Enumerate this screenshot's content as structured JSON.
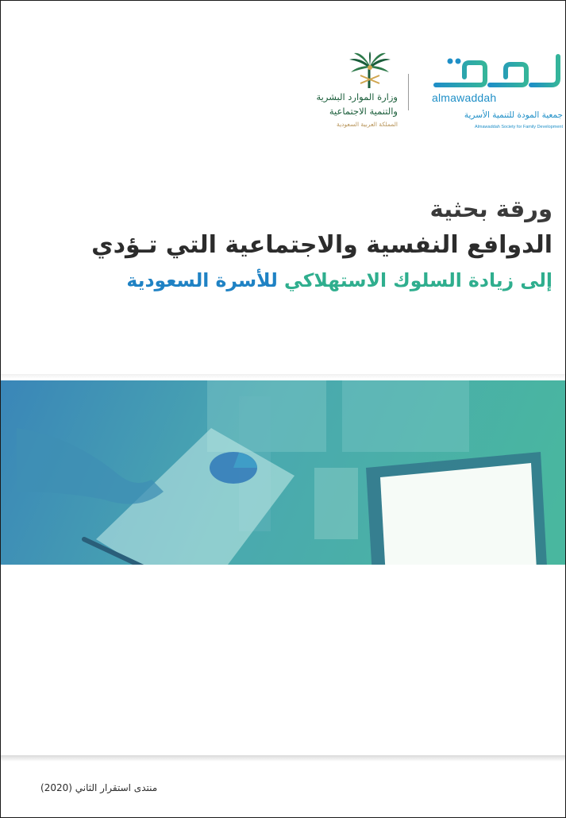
{
  "logos": {
    "mawaddah": {
      "mark_text": "المودة",
      "latin": "almawaddah",
      "arabic_name": "جمعية المودة للتنمية الأسرية",
      "english_name": "Almawaddah Society for Family Development"
    },
    "ministry": {
      "line1": "وزارة الموارد البشرية",
      "line2": "والتنمية الاجتماعية",
      "line3": "المملكة العربية السعودية"
    }
  },
  "title": {
    "line1": "ورقة بحثية",
    "line2": "الدوافع النفسية والاجتماعية التي تـؤدي",
    "line3_part1": "إلى زيادة السلوك الاستهلاكي",
    "line3_part2": " للأسرة السعودية"
  },
  "footer": {
    "text": "منتدى استقرار الثاني (2020)"
  },
  "colors": {
    "teal": "#2fae8e",
    "blue": "#1f82c4",
    "ministry_green": "#1b5e3b",
    "ministry_gold": "#b8955a"
  }
}
